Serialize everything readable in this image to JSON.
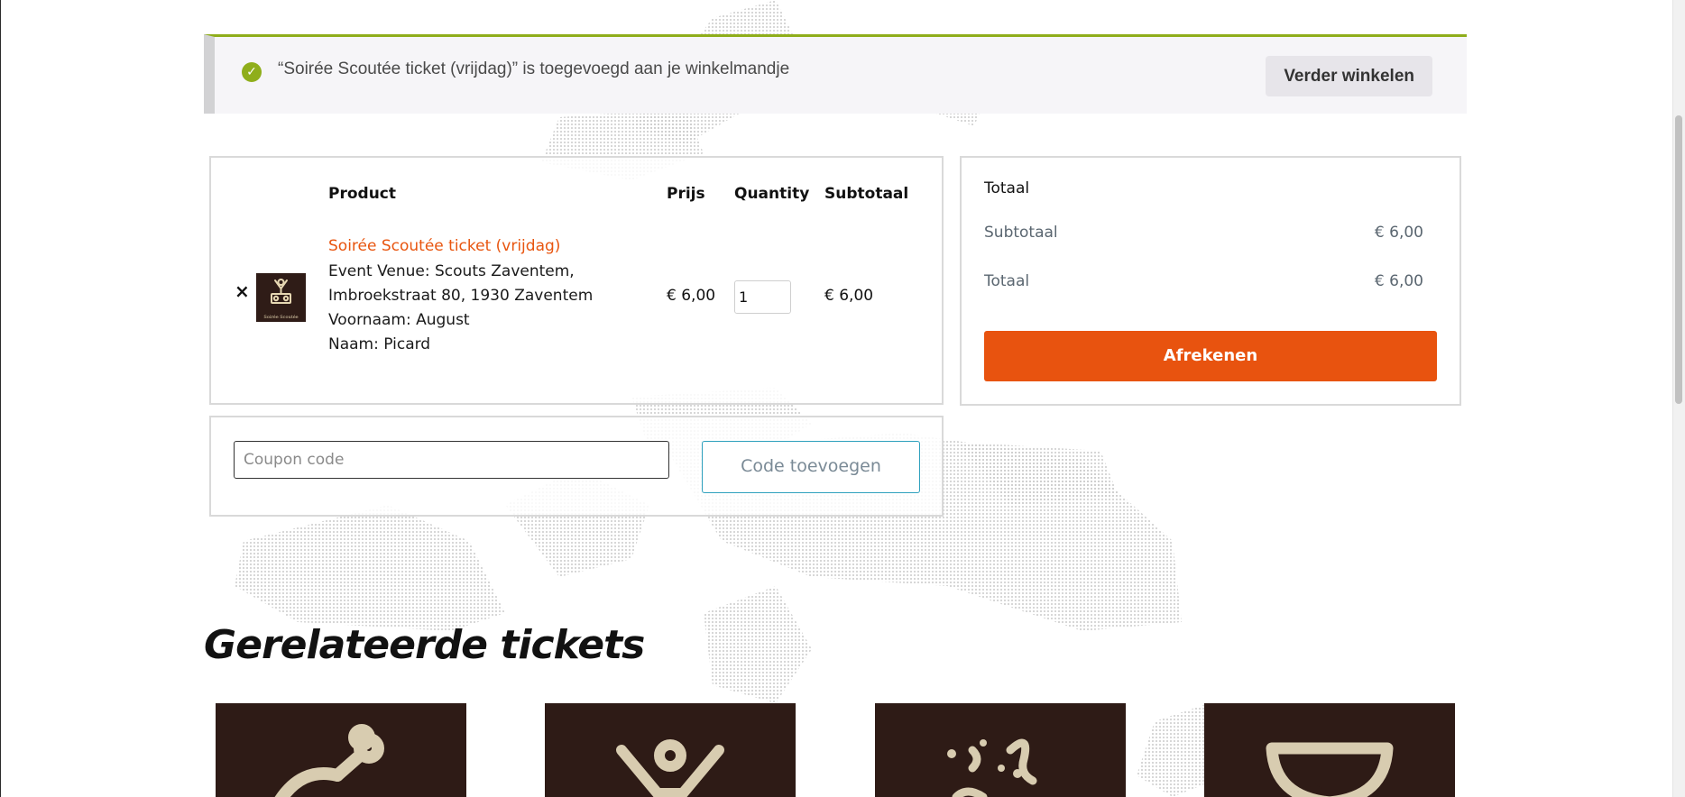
{
  "notice": {
    "message": "“Soirée Scoutée ticket (vrijdag)” is toegevoegd aan je winkelmandje",
    "button": "Verder winkelen",
    "accent_color": "#8fae1b"
  },
  "cart": {
    "headers": {
      "product": "Product",
      "price": "Prijs",
      "quantity": "Quantity",
      "subtotal": "Subtotaal"
    },
    "item": {
      "remove_icon": "×",
      "thumbnail_caption": "Soirée Scoutée",
      "name": "Soirée Scoutée ticket (vrijdag)",
      "meta": [
        "Event Venue: Scouts Zaventem,",
        "Imbroekstraat 80, 1930 Zaventem",
        "Voornaam: August",
        "Naam: Picard"
      ],
      "price": "€ 6,00",
      "quantity": "1",
      "subtotal": "€ 6,00"
    }
  },
  "coupon": {
    "placeholder": "Coupon code",
    "button": "Code toevoegen"
  },
  "totals": {
    "title": "Totaal",
    "subtotal_label": "Subtotaal",
    "subtotal_value": "€ 6,00",
    "total_label": "Totaal",
    "total_value": "€ 6,00",
    "checkout_button": "Afrekenen",
    "checkout_color": "#e8530f"
  },
  "related": {
    "heading": "Gerelateerde tickets",
    "cards": [
      {
        "icon": "drumstick-icon"
      },
      {
        "icon": "cheering-person-icon"
      },
      {
        "icon": "confetti-icon"
      },
      {
        "icon": "goblet-icon"
      }
    ]
  }
}
